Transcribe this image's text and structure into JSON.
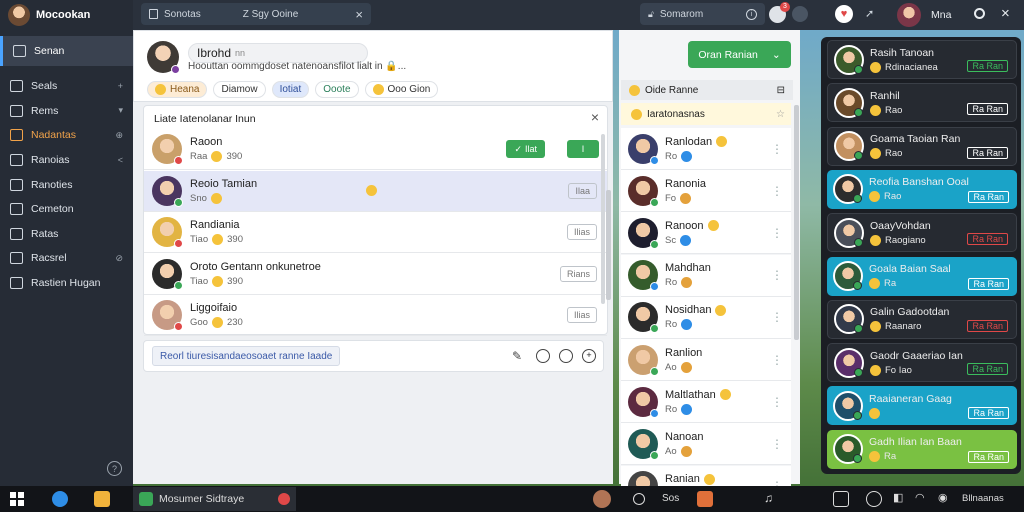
{
  "colors": {
    "accent": "#2e8de6",
    "green": "#3aa757",
    "sidebar": "#262c36",
    "highlight": "#e4e7f7",
    "bubble_teal": "#1aa3c8",
    "bubble_green": "#7ac142"
  },
  "sidebar": {
    "title": "Mocookan",
    "items": [
      {
        "label": "Senan",
        "icon": "home-icon",
        "right": ""
      },
      {
        "label": "Seals",
        "icon": "folder-icon",
        "right": "+"
      },
      {
        "label": "Rems",
        "icon": "folder-icon",
        "right": "▾"
      },
      {
        "label": "Nadantas",
        "icon": "chart-icon",
        "right": "⊕"
      },
      {
        "label": "Ranoias",
        "icon": "users-icon",
        "right": "<"
      },
      {
        "label": "Ranoties",
        "icon": "doc-icon",
        "right": ""
      },
      {
        "label": "Cemeton",
        "icon": "shield-icon",
        "right": ""
      },
      {
        "label": "Ratas",
        "icon": "calendar-icon",
        "right": ""
      },
      {
        "label": "Racsrel",
        "icon": "car-icon",
        "right": "⊘"
      },
      {
        "label": "Rastien Hugan",
        "icon": "archive-icon",
        "right": ""
      }
    ]
  },
  "topbar": {
    "tab_left": "Sonotas",
    "tab_right": "Z Sgy Ooine",
    "search": "Somarom",
    "user": "Mna",
    "notif_count": "3"
  },
  "post": {
    "author": "Ibrohd",
    "author_suffix": "nn",
    "text": "Hoouttan oommgdoset natenoansfilot lialt in 🔒...",
    "chips": [
      "Heana",
      "Diamow",
      "Iotiat",
      "Ooote",
      "Ooo Gion"
    ]
  },
  "contacts_panel": {
    "title": "Liate Iatenolanar Inun",
    "close": "×",
    "rows": [
      {
        "name": "Raoon",
        "meta": "Raa",
        "count": "390",
        "action1": "Ilat",
        "action2": "I",
        "tag": ""
      },
      {
        "name": "Reoio Tamian",
        "meta": "Sno",
        "count": "",
        "action1": "",
        "action2": "",
        "tag": "Ilaa"
      },
      {
        "name": "Randiania",
        "meta": "Tiao",
        "count": "390",
        "action1": "",
        "action2": "",
        "tag": "Ilias"
      },
      {
        "name": "Oroto Gentann onkunetroe",
        "meta": "Tiao",
        "count": "390",
        "action1": "",
        "action2": "",
        "tag": "Rians"
      },
      {
        "name": "Liggoifaio",
        "meta": "Goo",
        "count": "230",
        "action1": "",
        "action2": "",
        "tag": "Ilias"
      }
    ],
    "compose_placeholder": "Reorl tiuresisandaeosoaet ranne Iaade"
  },
  "right_panel": {
    "primary_button": "Oran Ranian",
    "header": "Oide Ranne",
    "pinned": "Iaratonasnas",
    "rows": [
      {
        "name": "Ranlodan",
        "meta": "Ro"
      },
      {
        "name": "Ranonia",
        "meta": "Fo"
      },
      {
        "name": "Ranoon",
        "meta": "Sc"
      },
      {
        "name": "Mahdhan",
        "meta": "Ro"
      },
      {
        "name": "Nosidhan",
        "meta": "Ro"
      },
      {
        "name": "Ranlion",
        "meta": "Ao"
      },
      {
        "name": "Maltlathan",
        "meta": "Ro"
      },
      {
        "name": "Nanoan",
        "meta": "Ao"
      },
      {
        "name": "Ranian",
        "meta": ""
      }
    ]
  },
  "bubbles": [
    {
      "name": "Rasih Tanoan",
      "meta": "Rdinacianea",
      "badge": "Ra Ran",
      "style": "dark",
      "badge_color": "#3bbd5d"
    },
    {
      "name": "Ranhil",
      "meta": "Rao",
      "badge": "Ra Ran",
      "style": "dark",
      "badge_color": "#ffffff"
    },
    {
      "name": "Goama Taoian Ran",
      "meta": "Rao",
      "badge": "Ra Ran",
      "style": "dark",
      "badge_color": "#ffffff"
    },
    {
      "name": "Reofia Banshan Ooal",
      "meta": "Rao",
      "badge": "Ra Ran",
      "style": "teal",
      "badge_color": "#ffffff"
    },
    {
      "name": "OaayVohdan",
      "meta": "Raogiano",
      "badge": "Ra Ran",
      "style": "dark",
      "badge_color": "#e04848"
    },
    {
      "name": "Goala Baian Saal",
      "meta": "Ra",
      "badge": "Ra Ran",
      "style": "teal",
      "badge_color": "#ffffff"
    },
    {
      "name": "Galin Gadootdan",
      "meta": "Raanaro",
      "badge": "Ra Ran",
      "style": "dark",
      "badge_color": "#e04848"
    },
    {
      "name": "Gaodr Gaaeriao Ian",
      "meta": "Fo Iao",
      "badge": "Ra Ran",
      "style": "dark",
      "badge_color": "#3bbd5d"
    },
    {
      "name": "Raaianeran Gaag",
      "meta": "",
      "badge": "Ra Ran",
      "style": "teal",
      "badge_color": "#ffffff"
    },
    {
      "name": "Gadh Ilian Ian Baan",
      "meta": "Ra",
      "badge": "Ra Ran",
      "style": "green",
      "badge_color": "#ffffff"
    }
  ],
  "taskbar": {
    "app_title": "Mosumer Sidtraye",
    "time": "Sos",
    "tray": "Bllnaanas"
  }
}
